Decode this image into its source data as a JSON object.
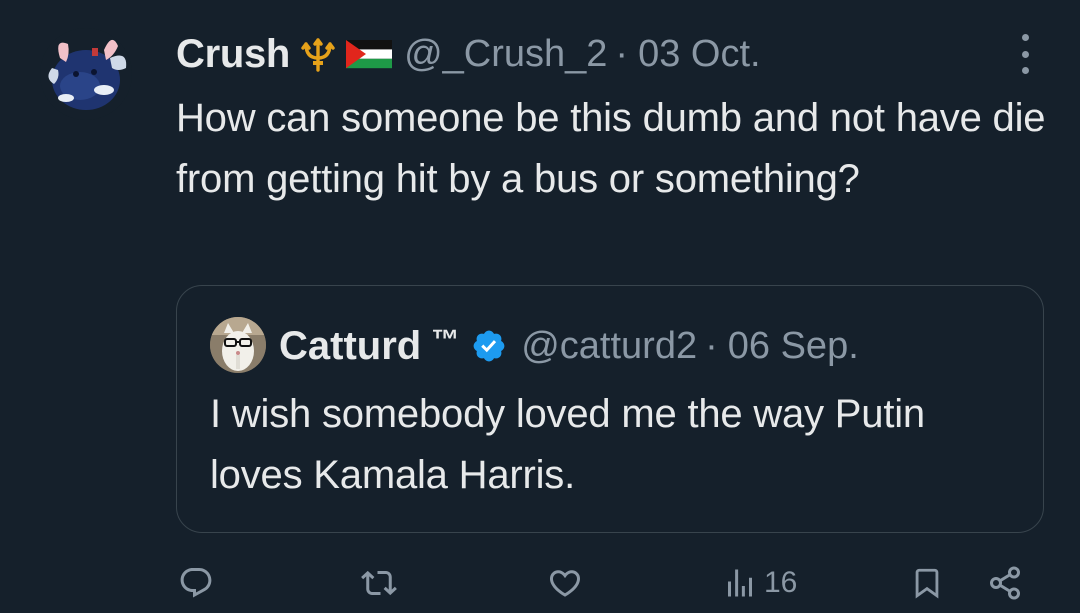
{
  "tweet": {
    "author_name": "Crush",
    "author_emoji": "trident-emoji palestine-flag-emoji",
    "handle": "@_Crush_2",
    "separator": "·",
    "date": "03 Oct.",
    "text": "How can someone be this dumb and not have die from getting hit by a bus or something?"
  },
  "quote": {
    "author_name": "Catturd",
    "author_mark": "™",
    "handle": "@catturd2",
    "separator": "·",
    "date": "06 Sep.",
    "text": "I wish somebody loved me the way Putin loves Kamala Harris.",
    "verified": true
  },
  "actions": {
    "view_count": "16"
  },
  "icons": {
    "reply": "reply-icon",
    "retweet": "retweet-icon",
    "like": "like-icon",
    "views": "views-icon",
    "bookmark": "bookmark-icon",
    "share": "share-icon",
    "more": "more-icon"
  },
  "colors": {
    "background": "#15202b",
    "text_primary": "#e7e9ea",
    "text_secondary": "#8b98a5",
    "border": "#38444d",
    "verified_blue": "#1d9bf0"
  }
}
